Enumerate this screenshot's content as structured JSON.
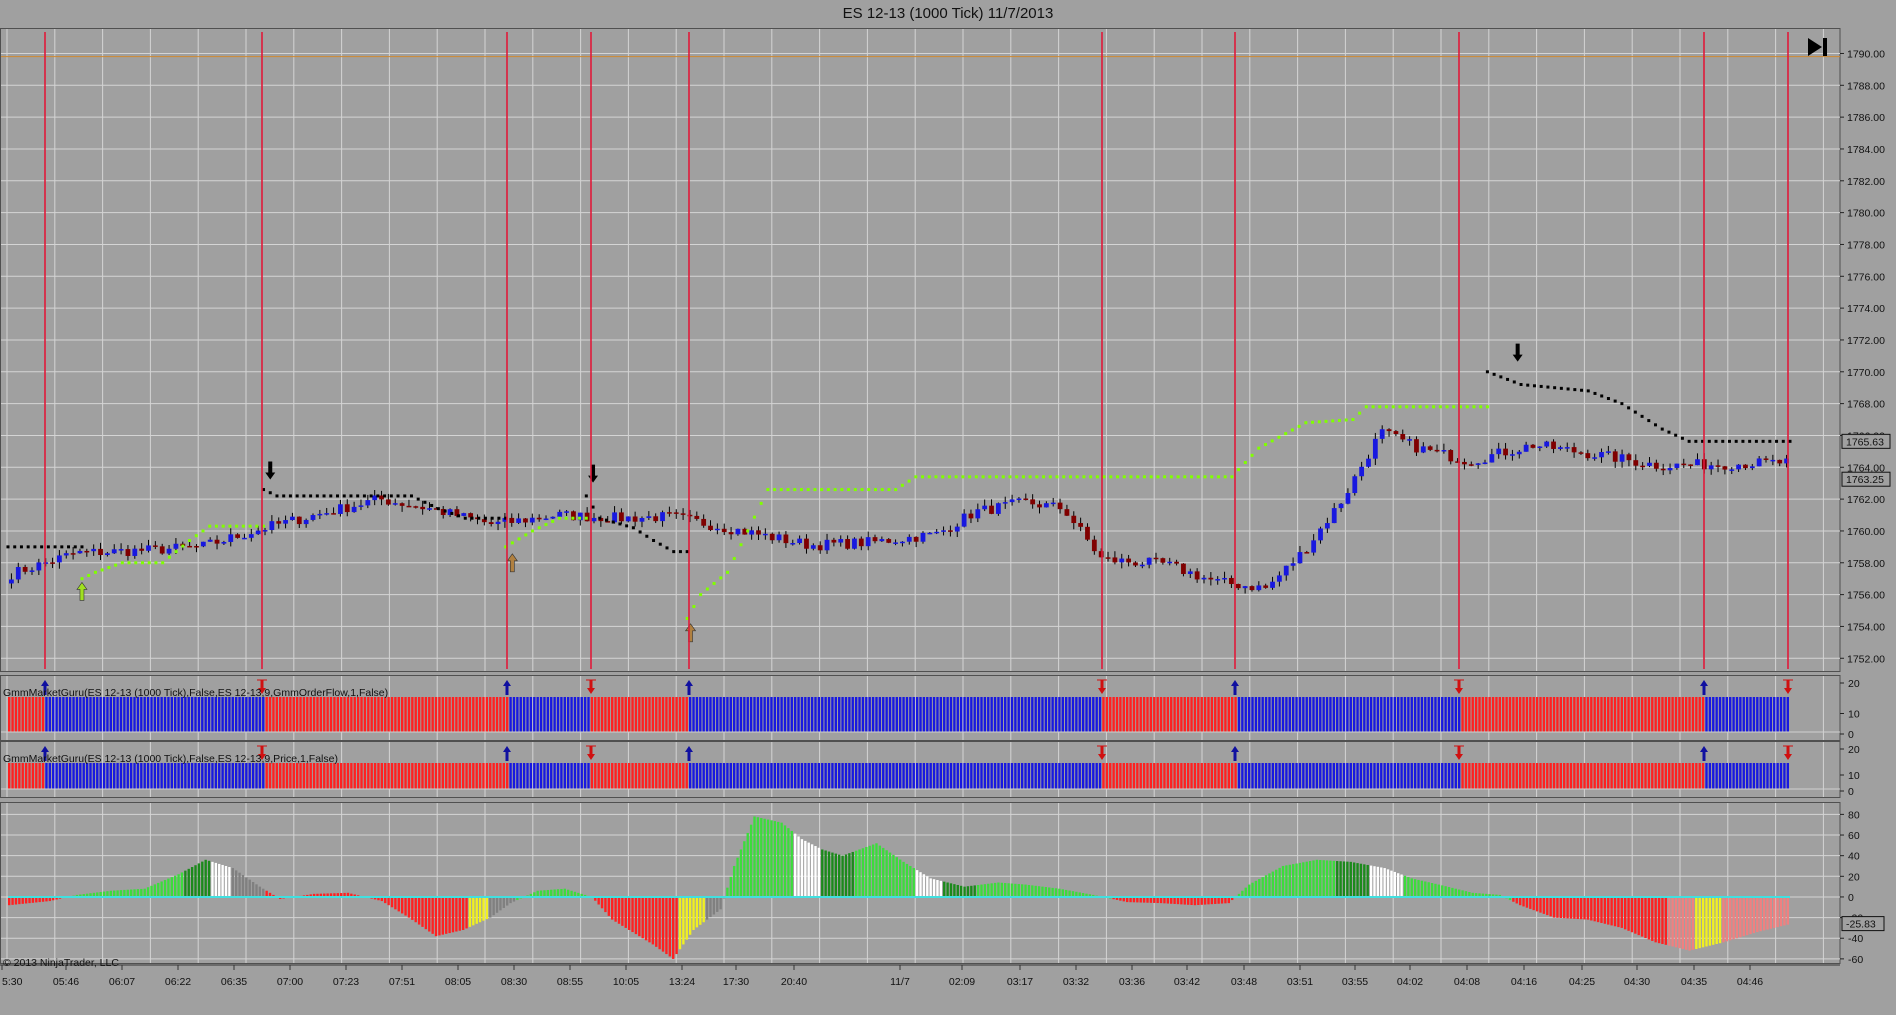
{
  "window": {
    "title": "ES 12-13 (1000 Tick)  11/7/2013",
    "copyright": "© 2013 NinjaTrader, LLC"
  },
  "icons": {
    "go_to_end": "skip-to-end-icon"
  },
  "chart_data": [
    {
      "type": "candlestick",
      "panel": "price",
      "instrument": "ES 12-13 (1000 Tick)",
      "date": "11/7/2013",
      "y_ticks": [
        1752.0,
        1754.0,
        1756.0,
        1758.0,
        1760.0,
        1762.0,
        1764.0,
        1766.0,
        1768.0,
        1770.0,
        1772.0,
        1774.0,
        1776.0,
        1778.0,
        1780.0,
        1782.0,
        1784.0,
        1786.0,
        1788.0,
        1790.0
      ],
      "ylim": [
        1751.2,
        1791.6
      ],
      "price_labels": [
        {
          "value": "1765.63",
          "price": 1765.63
        },
        {
          "value": "1763.25",
          "price": 1763.25
        }
      ],
      "x_tick_labels": [
        "5:30",
        "05:46",
        "06:07",
        "06:22",
        "06:35",
        "07:00",
        "07:23",
        "07:51",
        "08:05",
        "08:30",
        "08:55",
        "10:05",
        "13:24",
        "17:30",
        "20:40",
        "11/7",
        "02:09",
        "03:17",
        "03:32",
        "03:36",
        "03:42",
        "03:48",
        "03:51",
        "03:55",
        "04:02",
        "04:08",
        "04:16",
        "04:25",
        "04:30",
        "04:35",
        "04:46"
      ],
      "bar_count": 260,
      "close_anchors": [
        [
          0,
          1757.3
        ],
        [
          10,
          1758.6
        ],
        [
          22,
          1758.8
        ],
        [
          30,
          1759.0
        ],
        [
          40,
          1760.2
        ],
        [
          50,
          1761.2
        ],
        [
          58,
          1762.0
        ],
        [
          66,
          1761.4
        ],
        [
          76,
          1760.4
        ],
        [
          86,
          1761.0
        ],
        [
          96,
          1760.8
        ],
        [
          104,
          1760.9
        ],
        [
          114,
          1760.1
        ],
        [
          126,
          1759.1
        ],
        [
          136,
          1759.3
        ],
        [
          146,
          1759.8
        ],
        [
          152,
          1761.2
        ],
        [
          160,
          1761.8
        ],
        [
          166,
          1761.4
        ],
        [
          172,
          1758.2
        ],
        [
          182,
          1757.9
        ],
        [
          190,
          1756.8
        ],
        [
          198,
          1756.4
        ],
        [
          204,
          1758.8
        ],
        [
          210,
          1762.0
        ],
        [
          216,
          1766.2
        ],
        [
          222,
          1765.2
        ],
        [
          230,
          1764.4
        ],
        [
          240,
          1765.4
        ],
        [
          250,
          1764.8
        ],
        [
          260,
          1764.1
        ],
        [
          270,
          1764.2
        ],
        [
          280,
          1764.3
        ]
      ],
      "x_index_range": [
        0,
        280
      ],
      "series": [
        {
          "name": "trailing stop (short)",
          "color": "#000000",
          "segments": [
            [
              [
                0,
                1759.0
              ],
              [
                22,
                1759.0
              ]
            ],
            [
              [
                76,
                1762.6
              ],
              [
                80,
                1762.2
              ],
              [
                120,
                1762.2
              ],
              [
                128,
                1761.4
              ],
              [
                136,
                1760.8
              ],
              [
                148,
                1760.8
              ]
            ],
            [
              [
                172,
                1762.2
              ],
              [
                176,
                1760.8
              ],
              [
                186,
                1760.2
              ],
              [
                192,
                1759.4
              ],
              [
                198,
                1758.7
              ],
              [
                202,
                1758.7
              ]
            ],
            [
              [
                440,
                1770.0
              ],
              [
                450,
                1769.2
              ],
              [
                470,
                1768.8
              ],
              [
                480,
                1768.0
              ],
              [
                492,
                1766.4
              ],
              [
                500,
                1765.63
              ],
              [
                530,
                1765.63
              ]
            ]
          ]
        },
        {
          "name": "trailing stop (long)",
          "color": "#80ff00",
          "segments": [
            [
              [
                22,
                1757.0
              ],
              [
                26,
                1757.4
              ],
              [
                34,
                1758.0
              ],
              [
                46,
                1758.0
              ],
              [
                54,
                1759.4
              ],
              [
                60,
                1760.3
              ],
              [
                76,
                1760.3
              ]
            ],
            [
              [
                148,
                1759.0
              ],
              [
                156,
                1760.0
              ],
              [
                164,
                1760.8
              ],
              [
                172,
                1760.8
              ]
            ],
            [
              [
                202,
                1754.5
              ],
              [
                206,
                1756.0
              ],
              [
                214,
                1757.4
              ],
              [
                220,
                1760.0
              ],
              [
                226,
                1762.6
              ],
              [
                264,
                1762.6
              ],
              [
                270,
                1763.4
              ],
              [
                364,
                1763.4
              ],
              [
                372,
                1765.2
              ],
              [
                386,
                1766.8
              ],
              [
                400,
                1767.0
              ],
              [
                404,
                1767.8
              ],
              [
                440,
                1767.8
              ]
            ]
          ]
        }
      ],
      "signal_arrows": [
        {
          "dir": "up",
          "bar": 22,
          "price": 1756.2,
          "color": "#a0e020"
        },
        {
          "dir": "down",
          "bar": 78,
          "price": 1763.8,
          "color": "#000000"
        },
        {
          "dir": "up",
          "bar": 150,
          "price": 1758.0,
          "color": "#b08040"
        },
        {
          "dir": "down",
          "bar": 174,
          "price": 1763.6,
          "color": "#000000"
        },
        {
          "dir": "up",
          "bar": 203,
          "price": 1753.6,
          "color": "#b08040"
        },
        {
          "dir": "down",
          "bar": 449,
          "price": 1771.2,
          "color": "#000000"
        }
      ]
    },
    {
      "type": "histogram",
      "panel": "indicator-1",
      "label": "GmmMarketGuru(ES 12-13 (1000 Tick),False,ES 12-13,9,GmmOrderFlow,1,False)",
      "y_ticks": [
        20,
        10,
        0
      ],
      "segments": [
        {
          "from": 0,
          "to": 11,
          "color": "#ff2020"
        },
        {
          "from": 11,
          "to": 76,
          "color": "#1818e0"
        },
        {
          "from": 76,
          "to": 148,
          "color": "#ff2020"
        },
        {
          "from": 148,
          "to": 172,
          "color": "#1818e0"
        },
        {
          "from": 172,
          "to": 201,
          "color": "#ff2020"
        },
        {
          "from": 201,
          "to": 323,
          "color": "#1818e0"
        },
        {
          "from": 323,
          "to": 363,
          "color": "#ff2020"
        },
        {
          "from": 363,
          "to": 429,
          "color": "#1818e0"
        },
        {
          "from": 429,
          "to": 501,
          "color": "#ff2020"
        },
        {
          "from": 501,
          "to": 526,
          "color": "#1818e0"
        }
      ]
    },
    {
      "type": "histogram",
      "panel": "indicator-2",
      "label": "GmmMarketGuru(ES 12-13 (1000 Tick),False,ES 12-13,9,Price,1,False)",
      "y_ticks": [
        20,
        10,
        0
      ],
      "segments": [
        {
          "from": 0,
          "to": 11,
          "color": "#ff2020"
        },
        {
          "from": 11,
          "to": 76,
          "color": "#1818e0"
        },
        {
          "from": 76,
          "to": 148,
          "color": "#ff2020"
        },
        {
          "from": 148,
          "to": 172,
          "color": "#1818e0"
        },
        {
          "from": 172,
          "to": 201,
          "color": "#ff2020"
        },
        {
          "from": 201,
          "to": 323,
          "color": "#1818e0"
        },
        {
          "from": 323,
          "to": 363,
          "color": "#ff2020"
        },
        {
          "from": 363,
          "to": 429,
          "color": "#1818e0"
        },
        {
          "from": 429,
          "to": 501,
          "color": "#ff2020"
        },
        {
          "from": 501,
          "to": 526,
          "color": "#1818e0"
        }
      ]
    },
    {
      "type": "histogram",
      "panel": "oscillator",
      "y_ticks": [
        80,
        60,
        40,
        20,
        0,
        -20,
        -40,
        -60
      ],
      "ylim": [
        -64,
        92
      ],
      "current_value": "-25.83",
      "anchors": [
        [
          0,
          -8
        ],
        [
          12,
          -4
        ],
        [
          20,
          2
        ],
        [
          30,
          6
        ],
        [
          40,
          8
        ],
        [
          50,
          22
        ],
        [
          58,
          36
        ],
        [
          66,
          28
        ],
        [
          74,
          10
        ],
        [
          80,
          -2
        ],
        [
          90,
          3
        ],
        [
          100,
          4
        ],
        [
          110,
          -4
        ],
        [
          118,
          -20
        ],
        [
          126,
          -38
        ],
        [
          134,
          -32
        ],
        [
          142,
          -20
        ],
        [
          148,
          -6
        ],
        [
          156,
          6
        ],
        [
          164,
          8
        ],
        [
          172,
          0
        ],
        [
          178,
          -22
        ],
        [
          190,
          -46
        ],
        [
          196,
          -60
        ],
        [
          202,
          -32
        ],
        [
          210,
          -12
        ],
        [
          214,
          30
        ],
        [
          220,
          78
        ],
        [
          228,
          72
        ],
        [
          234,
          56
        ],
        [
          240,
          46
        ],
        [
          246,
          40
        ],
        [
          256,
          52
        ],
        [
          264,
          34
        ],
        [
          272,
          18
        ],
        [
          282,
          10
        ],
        [
          292,
          14
        ],
        [
          300,
          12
        ],
        [
          310,
          8
        ],
        [
          320,
          2
        ],
        [
          330,
          -5
        ],
        [
          340,
          -6
        ],
        [
          350,
          -8
        ],
        [
          360,
          -6
        ],
        [
          366,
          12
        ],
        [
          376,
          30
        ],
        [
          386,
          36
        ],
        [
          396,
          34
        ],
        [
          406,
          28
        ],
        [
          414,
          18
        ],
        [
          422,
          12
        ],
        [
          432,
          4
        ],
        [
          440,
          2
        ],
        [
          446,
          -8
        ],
        [
          456,
          -20
        ],
        [
          466,
          -22
        ],
        [
          476,
          -30
        ],
        [
          486,
          -44
        ],
        [
          496,
          -52
        ],
        [
          506,
          -44
        ],
        [
          516,
          -34
        ],
        [
          526,
          -26
        ]
      ],
      "color_segments": [
        {
          "from": 0,
          "to": 16,
          "color": "#ff2020"
        },
        {
          "from": 16,
          "to": 52,
          "color": "#3cdc3c"
        },
        {
          "from": 52,
          "to": 60,
          "color": "#1b8a1b"
        },
        {
          "from": 60,
          "to": 66,
          "color": "#ffffff"
        },
        {
          "from": 66,
          "to": 76,
          "color": "#808080"
        },
        {
          "from": 76,
          "to": 136,
          "color": "#ff2020"
        },
        {
          "from": 136,
          "to": 142,
          "color": "#f0f020"
        },
        {
          "from": 142,
          "to": 150,
          "color": "#808080"
        },
        {
          "from": 150,
          "to": 172,
          "color": "#3cdc3c"
        },
        {
          "from": 172,
          "to": 198,
          "color": "#ff2020"
        },
        {
          "from": 198,
          "to": 206,
          "color": "#f0f020"
        },
        {
          "from": 206,
          "to": 212,
          "color": "#808080"
        },
        {
          "from": 212,
          "to": 232,
          "color": "#3cdc3c"
        },
        {
          "from": 232,
          "to": 240,
          "color": "#ffffff"
        },
        {
          "from": 240,
          "to": 250,
          "color": "#1b8a1b"
        },
        {
          "from": 250,
          "to": 268,
          "color": "#3cdc3c"
        },
        {
          "from": 268,
          "to": 276,
          "color": "#ffffff"
        },
        {
          "from": 276,
          "to": 286,
          "color": "#1b8a1b"
        },
        {
          "from": 286,
          "to": 326,
          "color": "#3cdc3c"
        },
        {
          "from": 326,
          "to": 362,
          "color": "#ff2020"
        },
        {
          "from": 362,
          "to": 392,
          "color": "#3cdc3c"
        },
        {
          "from": 392,
          "to": 402,
          "color": "#1b8a1b"
        },
        {
          "from": 402,
          "to": 412,
          "color": "#ffffff"
        },
        {
          "from": 412,
          "to": 444,
          "color": "#3cdc3c"
        },
        {
          "from": 444,
          "to": 490,
          "color": "#ff2020"
        },
        {
          "from": 490,
          "to": 498,
          "color": "#f08080"
        },
        {
          "from": 498,
          "to": 506,
          "color": "#f0f020"
        },
        {
          "from": 506,
          "to": 526,
          "color": "#f08080"
        }
      ]
    }
  ],
  "signal_lines": {
    "color": "#e01a3a",
    "x_positions": [
      45,
      262,
      507,
      591,
      689,
      1102,
      1235,
      1459,
      1704,
      1788
    ],
    "panel_arrows": [
      {
        "dir": "up",
        "x": 45
      },
      {
        "dir": "down",
        "x": 262
      },
      {
        "dir": "up",
        "x": 507
      },
      {
        "dir": "down",
        "x": 591
      },
      {
        "dir": "up",
        "x": 689
      },
      {
        "dir": "down",
        "x": 1102
      },
      {
        "dir": "up",
        "x": 1235
      },
      {
        "dir": "down",
        "x": 1459
      },
      {
        "dir": "up",
        "x": 1704
      },
      {
        "dir": "down",
        "x": 1788
      }
    ]
  },
  "colors": {
    "background": "#a0a0a0",
    "grid": "#d4d4d4",
    "up_candle": "#1818e0",
    "down_candle": "#800000",
    "wick": "#000000",
    "signal_line": "#e01a3a",
    "zero_line": "#40e0e0"
  }
}
